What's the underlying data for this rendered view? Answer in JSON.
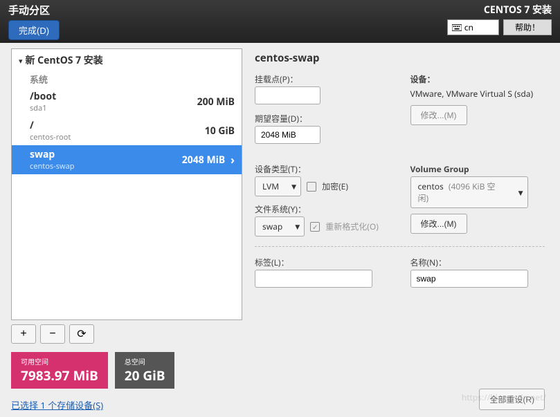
{
  "header": {
    "title": "手动分区",
    "done_label": "完成(D)",
    "installer_title": "CENTOS 7 安装",
    "lang_code": "cn",
    "help_label": "帮助！"
  },
  "tree": {
    "root_label": "新 CentOS 7 安装",
    "section_label": "系统",
    "partitions": [
      {
        "name": "/boot",
        "sub": "sda1",
        "size": "200 MiB",
        "selected": false
      },
      {
        "name": "/",
        "sub": "centos-root",
        "size": "10 GiB",
        "selected": false
      },
      {
        "name": "swap",
        "sub": "centos-swap",
        "size": "2048 MiB",
        "selected": true
      }
    ]
  },
  "toolbar": {
    "add": "+",
    "remove": "−",
    "reload": "⟳"
  },
  "space": {
    "avail_label": "可用空间",
    "avail_value": "7983.97 MiB",
    "total_label": "总空间",
    "total_value": "20 GiB"
  },
  "storage_link": "已选择 1 个存储设备(S)",
  "detail": {
    "title": "centos-swap",
    "mount_label": "挂载点(P)：",
    "mount_value": "",
    "capacity_label": "期望容量(D)：",
    "capacity_value": "2048 MiB",
    "device_label": "设备：",
    "device_value": "VMware, VMware Virtual S (sda)",
    "modify_label": "修改...(M)",
    "devtype_label": "设备类型(T)：",
    "devtype_value": "LVM",
    "encrypt_label": "加密(E)",
    "vg_label": "Volume Group",
    "vg_value": "centos",
    "vg_hint": "(4096 KiB 空闲)",
    "fs_label": "文件系统(Y)：",
    "fs_value": "swap",
    "reformat_label": "重新格式化(O)",
    "tag_label": "标签(L)：",
    "tag_value": "",
    "name_label": "名称(N)：",
    "name_value": "swap"
  },
  "footer": {
    "reset_label": "全部重设(R)"
  },
  "watermark": "https://blog.csdn.net/"
}
